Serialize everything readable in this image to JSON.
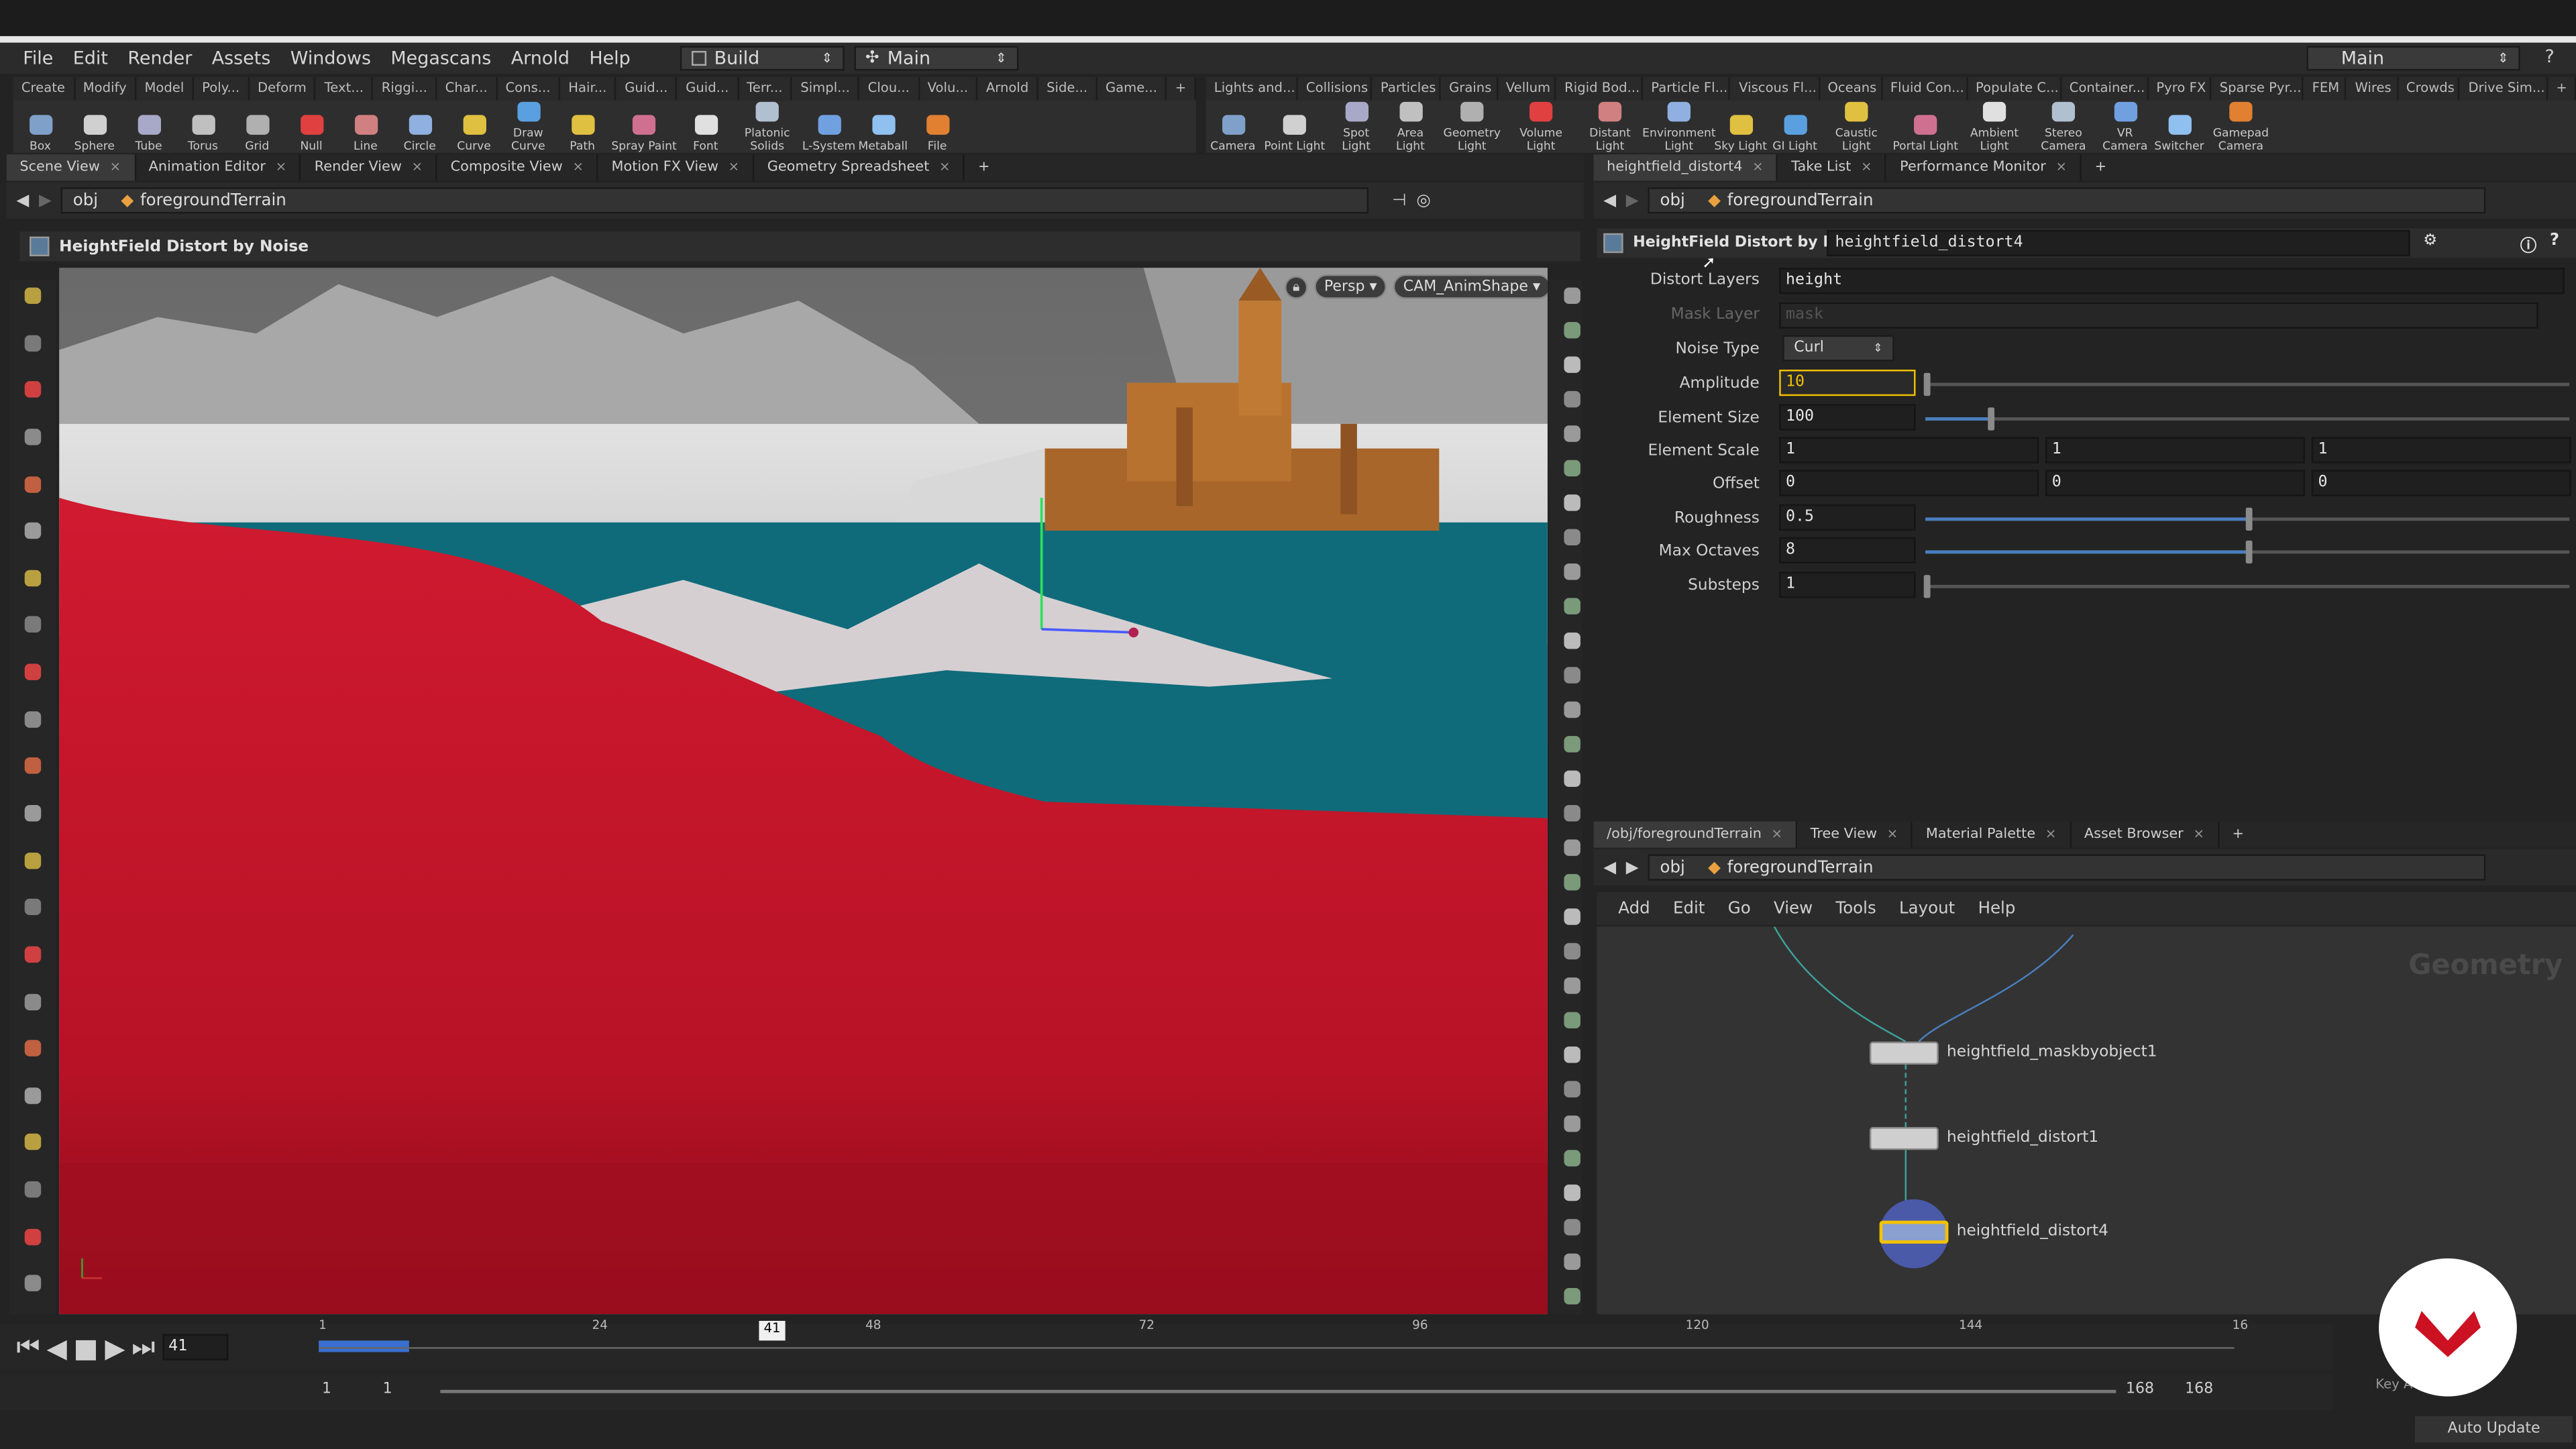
{
  "menu": {
    "items": [
      "File",
      "Edit",
      "Render",
      "Assets",
      "Windows",
      "Megascans",
      "Arnold",
      "Help"
    ],
    "desktop": "Build",
    "network": "Main",
    "right_desktop": "Main"
  },
  "shelf_tabs_left": [
    "Create",
    "Modify",
    "Model",
    "Poly...",
    "Deform",
    "Text...",
    "Riggi...",
    "Char...",
    "Cons...",
    "Hair...",
    "Guid...",
    "Guid...",
    "Terr...",
    "Simpl...",
    "Clou...",
    "Volu...",
    "Arnold",
    "Side...",
    "Game..."
  ],
  "tools_left": [
    "Box",
    "Sphere",
    "Tube",
    "Torus",
    "Grid",
    "Null",
    "Line",
    "Circle",
    "Curve",
    "Draw Curve",
    "Path",
    "Spray Paint",
    "Font",
    "Platonic Solids",
    "L-System",
    "Metaball",
    "File"
  ],
  "shelf_tabs_right": [
    "Lights and...",
    "Collisions",
    "Particles",
    "Grains",
    "Vellum",
    "Rigid Bod...",
    "Particle Fl...",
    "Viscous Fl...",
    "Oceans",
    "Fluid Con...",
    "Populate C...",
    "Container...",
    "Pyro FX",
    "Sparse Pyr...",
    "FEM",
    "Wires",
    "Crowds",
    "Drive Sim..."
  ],
  "tools_right": [
    "Camera",
    "Point Light",
    "Spot Light",
    "Area Light",
    "Geometry Light",
    "Volume Light",
    "Distant Light",
    "Environment Light",
    "Sky Light",
    "GI Light",
    "Caustic Light",
    "Portal Light",
    "Ambient Light",
    "Stereo Camera",
    "VR Camera",
    "Switcher",
    "Gamepad Camera"
  ],
  "left_tabs": [
    "Scene View",
    "Animation Editor",
    "Render View",
    "Composite View",
    "Motion FX View",
    "Geometry Spreadsheet"
  ],
  "path": {
    "root": "obj",
    "node": "foregroundTerrain"
  },
  "viewport": {
    "title": "HeightField Distort by Noise",
    "persp": "Persp",
    "camera": "CAM_AnimShape"
  },
  "param_tabs": [
    "heightfield_distort4",
    "Take List",
    "Performance Monitor"
  ],
  "params": {
    "type_label": "HeightField Distort by Noise",
    "node_name": "heightfield_distort4",
    "distort_layers_label": "Distort Layers",
    "distort_layers": "height",
    "mask_layer_label": "Mask Layer",
    "mask_layer": "mask",
    "noise_type_label": "Noise Type",
    "noise_type": "Curl",
    "amplitude_label": "Amplitude",
    "amplitude": "10",
    "element_size_label": "Element Size",
    "element_size": "100",
    "element_scale_label": "Element Scale",
    "element_scale": [
      "1",
      "1",
      "1"
    ],
    "offset_label": "Offset",
    "offset": [
      "0",
      "0",
      "0"
    ],
    "roughness_label": "Roughness",
    "roughness": "0.5",
    "max_octaves_label": "Max Octaves",
    "max_octaves": "8",
    "substeps_label": "Substeps",
    "substeps": "1"
  },
  "sliders": {
    "amplitude": 0.0,
    "element_size": 0.1,
    "roughness": 0.5,
    "max_octaves": 0.5,
    "substeps": 0.0
  },
  "network_tabs": [
    "/obj/foregroundTerrain",
    "Tree View",
    "Material Palette",
    "Asset Browser"
  ],
  "network_menu": [
    "Add",
    "Edit",
    "Go",
    "View",
    "Tools",
    "Layout",
    "Help"
  ],
  "network_context": "Geometry",
  "nodes": [
    "heightfield_maskbyobject1",
    "heightfield_distort1",
    "heightfield_distort4"
  ],
  "timeline": {
    "frame": "41",
    "marker": "41",
    "ticks": [
      "1",
      "24",
      "48",
      "72",
      "96",
      "120",
      "144",
      "16"
    ],
    "start": "1",
    "start2": "1",
    "end": "168",
    "end2": "168",
    "update_mode": "Auto Update",
    "key": "Key A"
  },
  "colors": {
    "accent": "#4a7fbf",
    "terrain_red": "#c8182a",
    "water": "#0f6b7a",
    "selected": "#f2c200",
    "logo": "#cc1122"
  }
}
